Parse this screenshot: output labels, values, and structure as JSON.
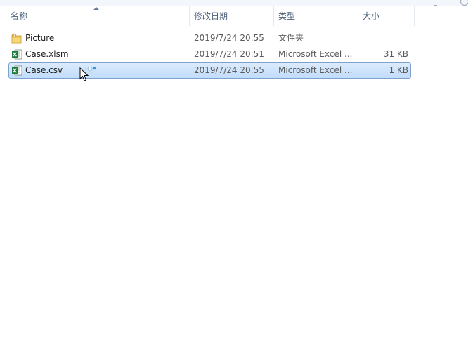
{
  "columns": {
    "name": "名称",
    "date": "修改日期",
    "type": "类型",
    "size": "大小"
  },
  "files": [
    {
      "icon": "folder-icon",
      "name": "Picture",
      "date": "2019/7/24 20:55",
      "type": "文件夹",
      "size": "",
      "selected": false
    },
    {
      "icon": "excel-file-icon",
      "name": "Case.xlsm",
      "date": "2019/7/24 20:51",
      "type": "Microsoft Excel ...",
      "size": "31 KB",
      "selected": false
    },
    {
      "icon": "excel-file-icon",
      "name": "Case.csv",
      "date": "2019/7/24 20:55",
      "type": "Microsoft Excel ...",
      "size": "1 KB",
      "selected": true
    }
  ],
  "colors": {
    "selection_fill": "#c9e0fc",
    "selection_border": "#7da2ce",
    "header_text": "#4c607a",
    "folder_yellow": "#f2c14e",
    "excel_green": "#1d7a3d"
  }
}
